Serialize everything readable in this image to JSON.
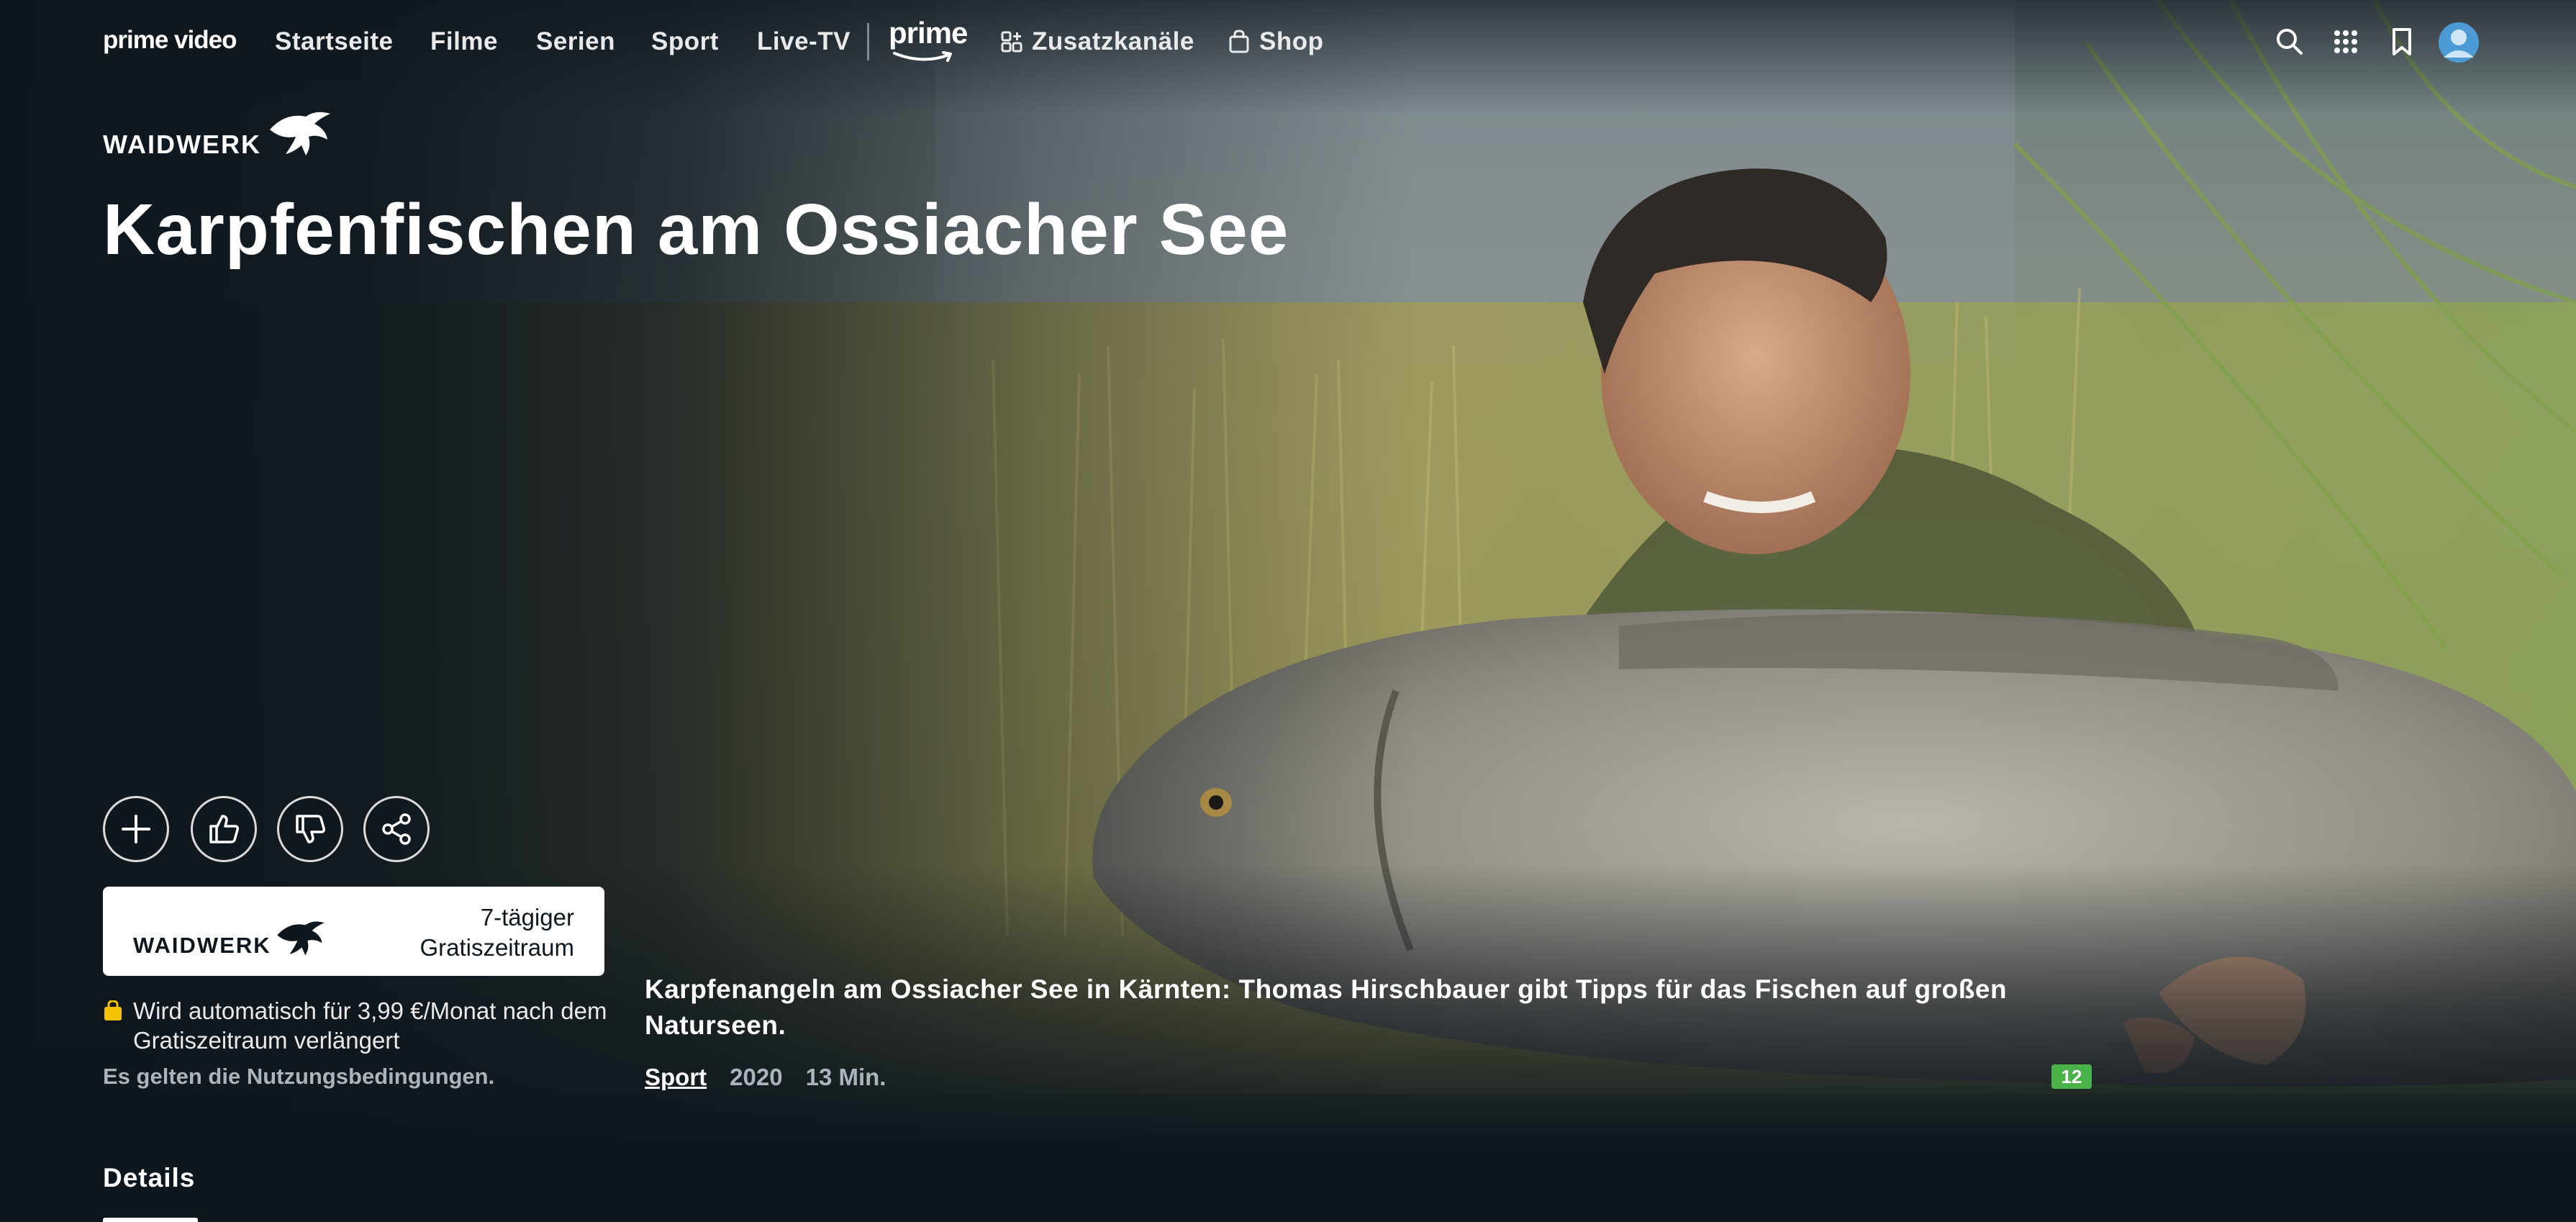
{
  "nav": {
    "logo": "prime video",
    "items": [
      "Startseite",
      "Filme",
      "Serien",
      "Sport",
      "Live-TV"
    ],
    "prime_label": "prime",
    "channels_label": "Zusatzkanäle",
    "shop_label": "Shop",
    "icons": [
      "search-icon",
      "grid-icon",
      "watchlist-icon",
      "profile-avatar"
    ]
  },
  "hero": {
    "brand": "WAIDWERK",
    "title": "Karpfenfischen am Ossiacher See",
    "actions": [
      "add-icon",
      "thumbs-up-icon",
      "thumbs-down-icon",
      "share-icon"
    ],
    "channel_card": {
      "brand": "WAIDWERK",
      "trial_line1": "7-tägiger",
      "trial_line2": "Gratiszeitraum"
    },
    "renewal": "Wird automatisch für 3,99 €/Monat nach dem Gratiszeitraum verlängert",
    "terms": "Es gelten die Nutzungsbedingungen.",
    "description": "Karpfenangeln am Ossiacher See in Kärnten: Thomas Hirschbauer gibt Tipps für das Fischen auf großen Naturseen.",
    "genre": "Sport",
    "year": "2020",
    "duration": "13 Min.",
    "age_rating": "12",
    "age_rating_color": "#49b34a"
  },
  "tabs": {
    "details": "Details"
  },
  "colors": {
    "background": "#0f171e",
    "text_secondary": "#aab4bd"
  }
}
